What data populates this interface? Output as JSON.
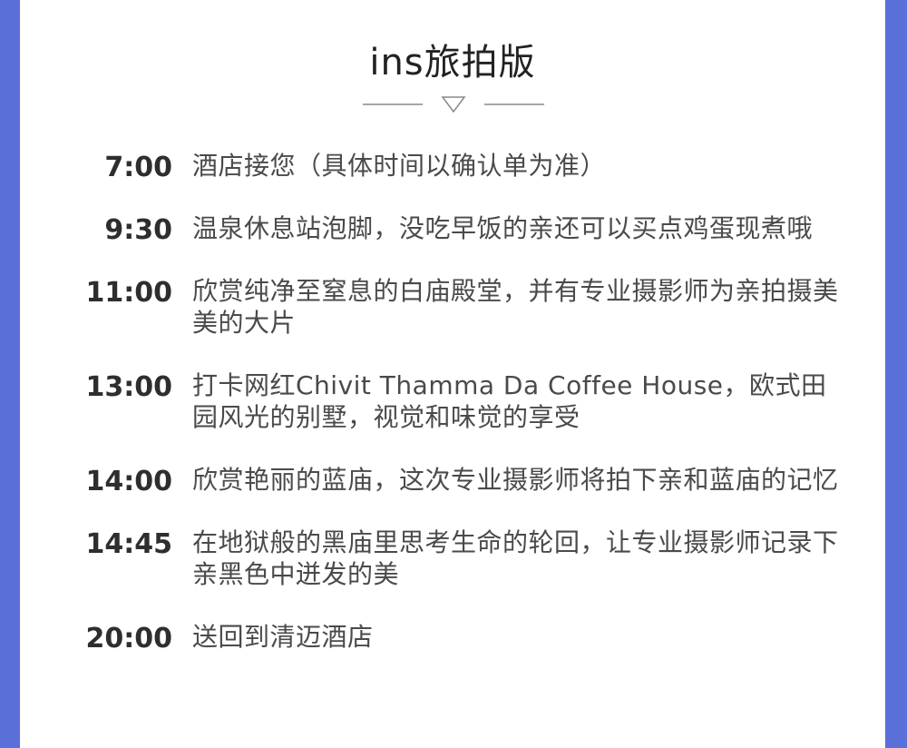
{
  "title": "ins旅拍版",
  "schedule": [
    {
      "time": "7:00",
      "desc": "酒店接您（具体时间以确认单为准）"
    },
    {
      "time": "9:30",
      "desc": "温泉休息站泡脚，没吃早饭的亲还可以买点鸡蛋现煮哦"
    },
    {
      "time": "11:00",
      "desc": "欣赏纯净至窒息的白庙殿堂，并有专业摄影师为亲拍摄美美的大片"
    },
    {
      "time": "13:00",
      "desc": "打卡网红Chivit Thamma Da Coffee House，欧式田园风光的别墅，视觉和味觉的享受"
    },
    {
      "time": "14:00",
      "desc": "欣赏艳丽的蓝庙，这次专业摄影师将拍下亲和蓝庙的记忆"
    },
    {
      "time": "14:45",
      "desc": "在地狱般的黑庙里思考生命的轮回，让专业摄影师记录下亲黑色中迸发的美"
    },
    {
      "time": "20:00",
      "desc": "送回到清迈酒店"
    }
  ],
  "colors": {
    "frame": "#5a6fd8",
    "card": "#ffffff",
    "divider": "#888888"
  },
  "icons": {
    "divider_marker": "down-triangle-outline"
  }
}
